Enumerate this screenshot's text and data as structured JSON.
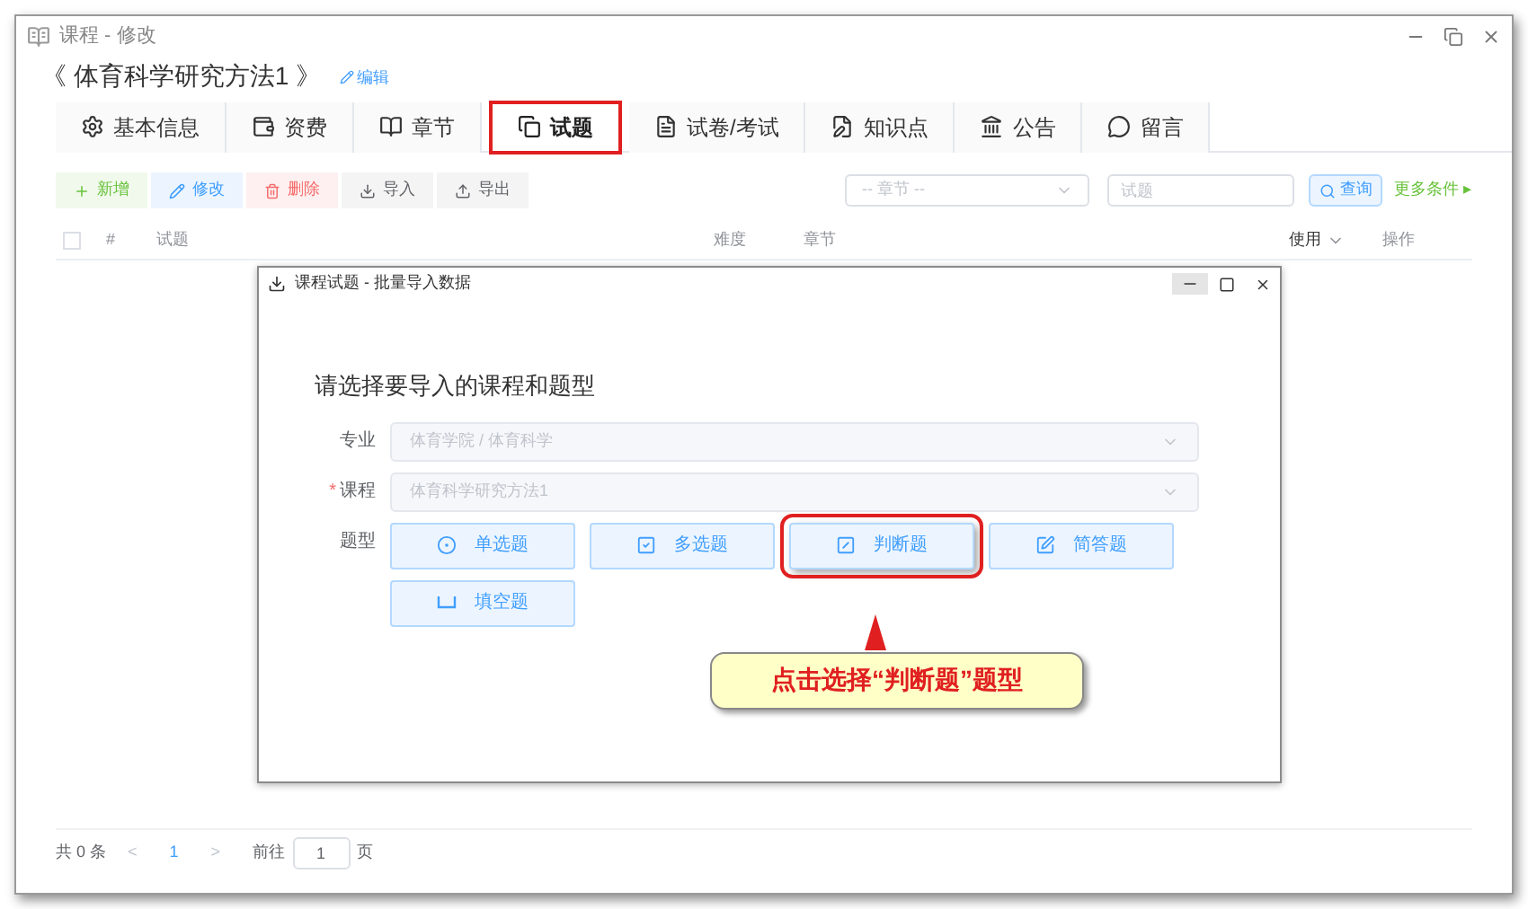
{
  "window": {
    "title": "课程 - 修改"
  },
  "course": {
    "title": "《 体育科学研究方法1 》",
    "edit_link": "编辑"
  },
  "tabs": [
    {
      "kind": "gear",
      "label": "基本信息",
      "selected": false
    },
    {
      "kind": "coin",
      "label": "资费",
      "selected": false
    },
    {
      "kind": "book",
      "label": "章节",
      "selected": false
    },
    {
      "kind": "copy",
      "label": "试题",
      "selected": true
    },
    {
      "kind": "paper",
      "label": "试卷/考试",
      "selected": false
    },
    {
      "kind": "pen",
      "label": "知识点",
      "selected": false
    },
    {
      "kind": "notice",
      "label": "公告",
      "selected": false
    },
    {
      "kind": "chat",
      "label": "留言",
      "selected": false
    }
  ],
  "toolbar": [
    {
      "kind": "add",
      "label": "新增"
    },
    {
      "kind": "edit",
      "label": "修改"
    },
    {
      "kind": "delete",
      "label": "删除"
    },
    {
      "kind": "import",
      "label": "导入"
    },
    {
      "kind": "export",
      "label": "导出"
    }
  ],
  "filters": {
    "chapter_placeholder": "-- 章节 --",
    "question_placeholder": "试题",
    "search_button": "查询",
    "more_link": "更多条件 ▸"
  },
  "table": {
    "select_all_checked": false,
    "columns": [
      {
        "kind": "check"
      },
      {
        "kind": "text",
        "label": "#"
      },
      {
        "kind": "text",
        "label": "试题"
      },
      {
        "kind": "text",
        "label": "难度"
      },
      {
        "kind": "text",
        "label": "章节"
      },
      {
        "kind": "sort",
        "label": "使用"
      },
      {
        "kind": "text",
        "label": "操作"
      }
    ]
  },
  "pagination": {
    "total": "共 0 条",
    "prev": "<",
    "page": "1",
    "next": ">",
    "goto": "前往",
    "page_input": "1",
    "page_unit": "页"
  },
  "dialog": {
    "title": "课程试题 - 批量导入数据",
    "heading": "请选择要导入的课程和题型",
    "fields": [
      {
        "label": "专业",
        "value": "体育学院 / 体育科学"
      },
      {
        "required_mark": "*",
        "label": "课程",
        "value": "体育科学研究方法1"
      }
    ],
    "type_label": "题型",
    "types": [
      {
        "kind": "single",
        "label": "单选题",
        "highlighted": false
      },
      {
        "kind": "multi",
        "label": "多选题",
        "highlighted": false
      },
      {
        "kind": "judge",
        "label": "判断题",
        "highlighted": true
      },
      {
        "kind": "short",
        "label": "简答题",
        "highlighted": false
      },
      {
        "kind": "blank",
        "label": "填空题",
        "highlighted": false
      }
    ]
  },
  "callout": {
    "text": "点击选择“判断题”题型"
  }
}
